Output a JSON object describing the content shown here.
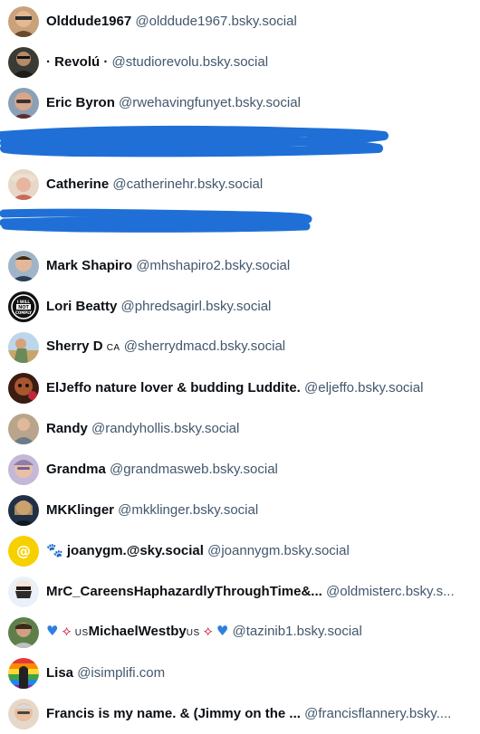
{
  "accounts": [
    {
      "name": "Olddude1967",
      "handle": "@olddude1967.bsky.social"
    },
    {
      "name": "· Revolú ·",
      "handle": "@studiorevolu.bsky.social"
    },
    {
      "name": "Eric Byron",
      "handle": "@rwehavingfunyet.bsky.social"
    },
    {
      "name": "",
      "handle": "",
      "redacted": true
    },
    {
      "name": "Catherine",
      "handle": "@catherinehr.bsky.social"
    },
    {
      "name": "",
      "handle": "",
      "redacted": true
    },
    {
      "name": "Mark Shapiro",
      "handle": "@mhshapiro2.bsky.social"
    },
    {
      "name": "Lori Beatty",
      "handle": "@phredsagirl.bsky.social",
      "avatar_text": "I WILL NOT COMPLY"
    },
    {
      "name": "Sherry D",
      "name_suffix": "CA",
      "handle": "@sherrydmacd.bsky.social"
    },
    {
      "name": "ElJeffo nature lover & budding Luddite.",
      "handle": "@eljeffo.bsky.social"
    },
    {
      "name": "Randy",
      "handle": "@randyhollis.bsky.social"
    },
    {
      "name": "Grandma",
      "handle": "@grandmasweb.bsky.social"
    },
    {
      "name": "MKKlinger",
      "handle": "@mkklinger.bsky.social"
    },
    {
      "name": "joanygm.@sky.social",
      "name_prefix_emoji": "🐾",
      "handle": "@joannygm.bsky.social",
      "avatar_text": "@"
    },
    {
      "name": "MrC_CareensHaphazardlyThroughTime&...",
      "handle": "@oldmisterc.bsky.s..."
    },
    {
      "name": "MichaelWestby",
      "name_prefix": "US",
      "name_suffix": "US",
      "handle": "@tazinib1.bsky.social"
    },
    {
      "name": "Lisa",
      "handle": "@isimplifi.com"
    },
    {
      "name": "Francis is my name. & (Jimmy on the ...",
      "handle": "@francisflannery.bsky...."
    }
  ],
  "colors": {
    "name_text": "#0b0f14",
    "handle_text": "#42576c",
    "redaction_scribble": "#1f6fd6",
    "joany_avatar_bg": "#f7d000"
  },
  "icons": {
    "heart": "blue-heart-icon",
    "butterfly": "butterfly-icon",
    "paw": "paw-icon"
  }
}
